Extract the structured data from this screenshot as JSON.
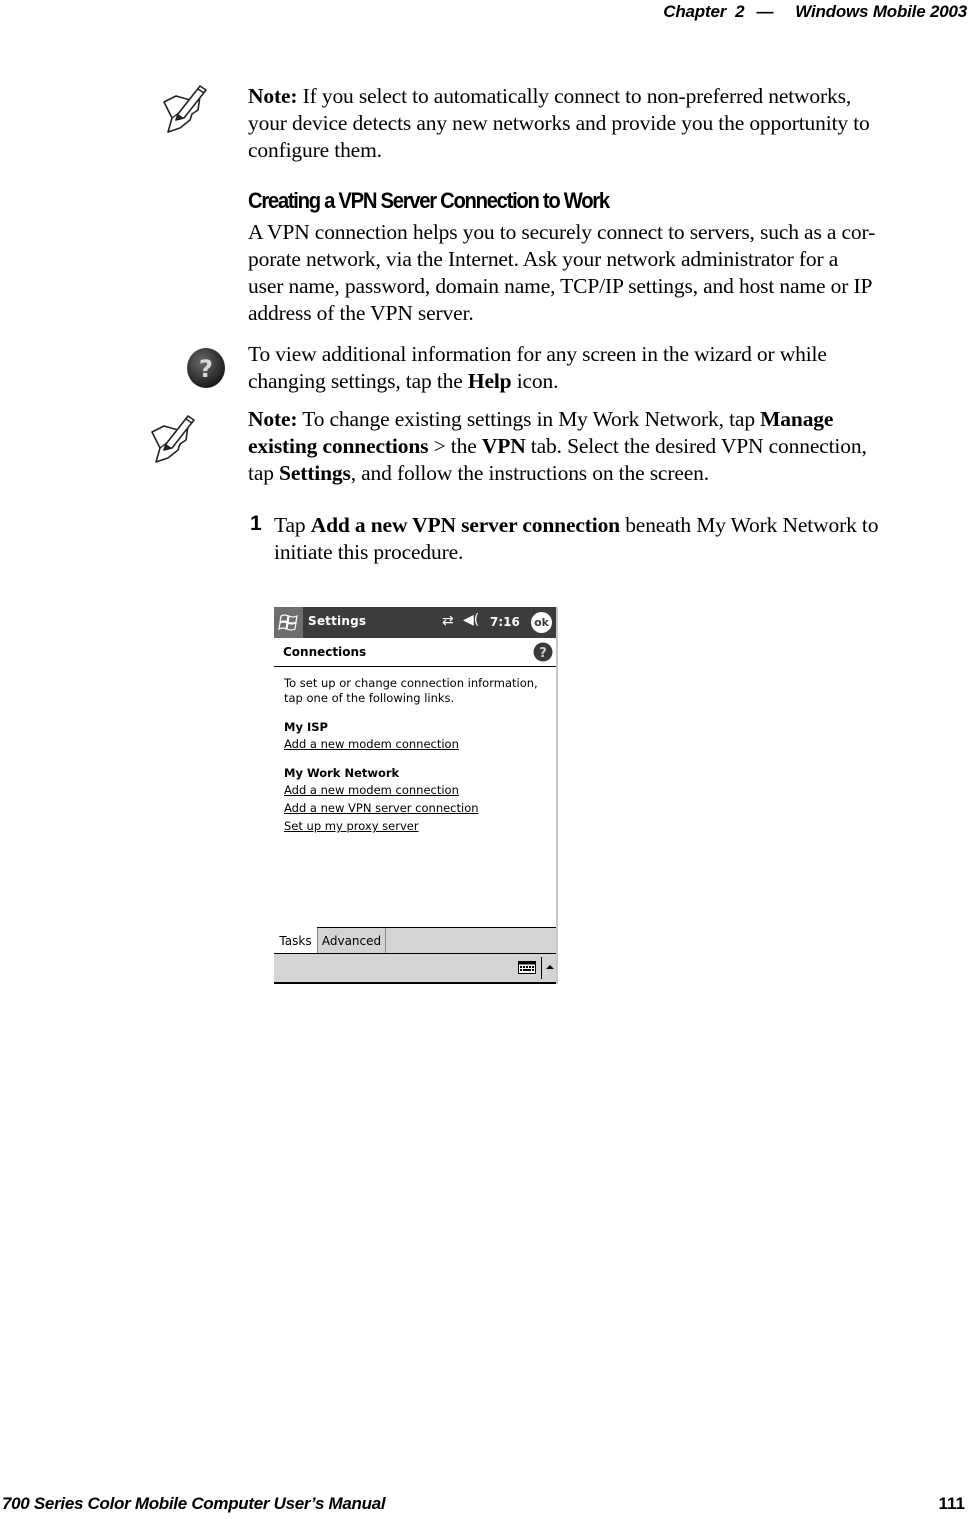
{
  "header": {
    "chapter": "Chapter",
    "chapter_num": "2",
    "dash": "—",
    "title": "Windows Mobile 2003"
  },
  "note1": {
    "icon": "note-pencil-icon",
    "label": "Note:",
    "line1": " If you select to automatically connect to non-preferred networks,",
    "line2": "your device detects any new networks and provide you the opportunity to",
    "line3": "configure them."
  },
  "section": {
    "heading": "Creating a VPN Server Connection to Work",
    "body_lines": [
      "A VPN connection helps you to securely connect to servers, such as a cor-",
      "porate network, via the Internet. Ask your network administrator for a",
      "user name, password, domain name, TCP/IP settings, and host name or IP",
      "address of the VPN server."
    ]
  },
  "help_tip": {
    "icon": "help-icon",
    "line1": "To view additional information for any screen in the wizard or while",
    "line2_pre": "changing settings, tap the ",
    "line2_bold": "Help",
    "line2_post": " icon."
  },
  "note2": {
    "icon": "note-pencil-icon",
    "label": "Note:",
    "l1_pre": " To change existing settings in My Work Network, tap ",
    "l1_bold": "Manage",
    "l2_bold1": "existing connections",
    "l2_mid": " > the ",
    "l2_bold2": "VPN",
    "l2_post": " tab. Select the desired VPN connection,",
    "l3_pre": "tap ",
    "l3_bold": "Settings",
    "l3_post": ", and follow the instructions on the screen."
  },
  "step1": {
    "number": "1",
    "pre": "Tap ",
    "bold": "Add a new VPN server connection",
    "post": " beneath My Work Network to",
    "line2": "initiate this procedure."
  },
  "device": {
    "titlebar": {
      "start_icon": "windows-flag-icon",
      "title": "Settings",
      "connectivity_icon": "connectivity-arrows-icon",
      "connectivity_glyph": "⇄",
      "volume_icon": "speaker-icon",
      "volume_glyph": "◀(",
      "time": "7:16",
      "ok_label": "ok"
    },
    "subheader": {
      "title": "Connections",
      "help_icon": "help-icon"
    },
    "intro": "To set up or change connection information, tap one of the following links.",
    "groups": [
      {
        "title": "My ISP",
        "links": [
          "Add a new modem connection"
        ]
      },
      {
        "title": "My Work Network",
        "links": [
          "Add a new modem connection",
          "Add a new VPN server connection",
          "Set up my proxy server"
        ]
      }
    ],
    "tabs": [
      {
        "label": "Tasks",
        "active": true
      },
      {
        "label": "Advanced",
        "active": false
      }
    ],
    "menubar": {
      "keyboard_icon": "keyboard-icon",
      "sip_arrow_icon": "up-arrow-icon"
    }
  },
  "footer": {
    "manual_title": "700 Series Color Mobile Computer User’s Manual",
    "page_number": "111"
  }
}
